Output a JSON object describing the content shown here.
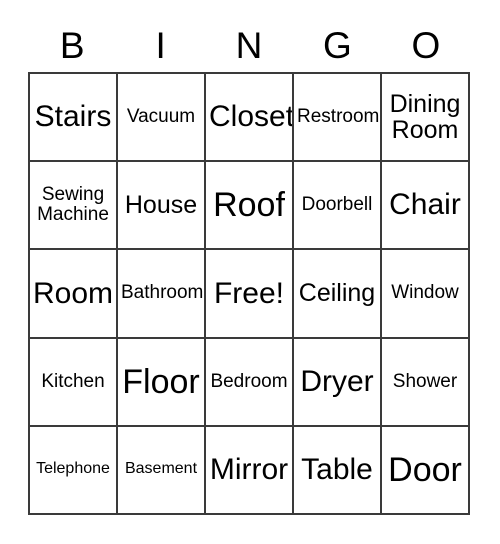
{
  "card": {
    "header_letters": [
      "B",
      "I",
      "N",
      "G",
      "O"
    ],
    "rows": [
      [
        {
          "label": "Stairs",
          "size": "lg"
        },
        {
          "label": "Vacuum",
          "size": "sm"
        },
        {
          "label": "Closet",
          "size": "lg"
        },
        {
          "label": "Restroom",
          "size": "sm"
        },
        {
          "label": "Dining\nRoom",
          "size": "md"
        }
      ],
      [
        {
          "label": "Sewing\nMachine",
          "size": "sm"
        },
        {
          "label": "House",
          "size": "md"
        },
        {
          "label": "Roof",
          "size": "xl"
        },
        {
          "label": "Doorbell",
          "size": "sm"
        },
        {
          "label": "Chair",
          "size": "lg"
        }
      ],
      [
        {
          "label": "Room",
          "size": "lg"
        },
        {
          "label": "Bathroom",
          "size": "sm"
        },
        {
          "label": "Free!",
          "size": "lg"
        },
        {
          "label": "Ceiling",
          "size": "md"
        },
        {
          "label": "Window",
          "size": "sm"
        }
      ],
      [
        {
          "label": "Kitchen",
          "size": "sm"
        },
        {
          "label": "Floor",
          "size": "xl"
        },
        {
          "label": "Bedroom",
          "size": "sm"
        },
        {
          "label": "Dryer",
          "size": "lg"
        },
        {
          "label": "Shower",
          "size": "sm"
        }
      ],
      [
        {
          "label": "Telephone",
          "size": "xs"
        },
        {
          "label": "Basement",
          "size": "xs"
        },
        {
          "label": "Mirror",
          "size": "lg"
        },
        {
          "label": "Table",
          "size": "lg"
        },
        {
          "label": "Door",
          "size": "xl"
        }
      ]
    ],
    "free_space": {
      "row": 2,
      "column": 2,
      "label": "Free!"
    },
    "colors": {
      "background": "#ffffff",
      "text": "#000000",
      "grid_line": "#3a3a3a"
    }
  }
}
